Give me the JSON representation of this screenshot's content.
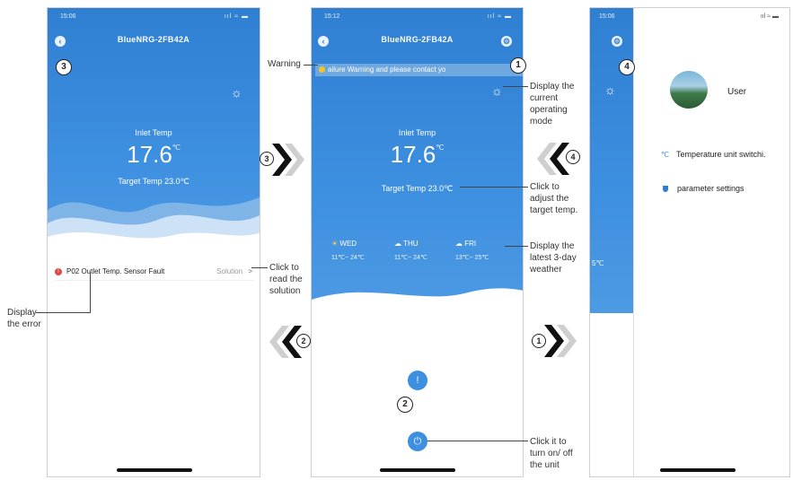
{
  "phone1": {
    "status_time": "15:06",
    "status_icons": "ııl ≈ ▬",
    "title": "BlueNRG-2FB42A",
    "inlet_label": "Inlet Temp",
    "inlet_value": "17.6",
    "unit": "℃",
    "target_label": "Target Temp",
    "target_value": "23.0℃",
    "error_text": "P02 Outlet Temp. Sensor Fault",
    "solution_label": "Solution",
    "solution_chevron": ">",
    "badge_back": "3"
  },
  "phone2": {
    "status_time": "15:12",
    "status_icons": "ııl ≈ ▬",
    "title": "BlueNRG-2FB42A",
    "warning_text": "ailure Warning and please contact yo",
    "inlet_label": "Inlet Temp",
    "inlet_value": "17.6",
    "unit": "℃",
    "target_label": "Target Temp",
    "target_value": "23.0℃",
    "weather": [
      {
        "day": "WED",
        "range": "11℃~ 24℃"
      },
      {
        "day": "THU",
        "range": "11℃~ 24℃"
      },
      {
        "day": "FRI",
        "range": "13℃~ 25℃"
      }
    ],
    "badge_settings": "1",
    "badge_info": "2"
  },
  "phone3": {
    "status_time": "15:06",
    "status_icons": "ııl ≈ ▬",
    "user_label": "User",
    "menu_unit": "Temperature unit switchi.",
    "menu_unit_icon": "℃",
    "menu_params": "parameter settings",
    "badge_settings": "4",
    "weather_partial": "",
    "weather_range_partial": "5℃"
  },
  "callouts": {
    "warning": "Warning",
    "mode": [
      "Display the",
      "current",
      "operating",
      "mode"
    ],
    "adjust": [
      "Click to",
      "adjust the",
      "target temp."
    ],
    "weather": [
      "Display the",
      "latest 3-day",
      "weather"
    ],
    "read_solution": [
      "Click to",
      "read the",
      "solution"
    ],
    "display_error": [
      "Display",
      "the error"
    ],
    "power": [
      "Click it to",
      "turn on/ off",
      "the unit"
    ]
  },
  "arrows": {
    "a3": "3",
    "a4": "4",
    "a2": "2",
    "a1": "1"
  },
  "colors": {
    "accent": "#2f7fd2",
    "error": "#e04848",
    "warning_bar": "#6fa7df",
    "warning_dot": "#f3c423"
  }
}
